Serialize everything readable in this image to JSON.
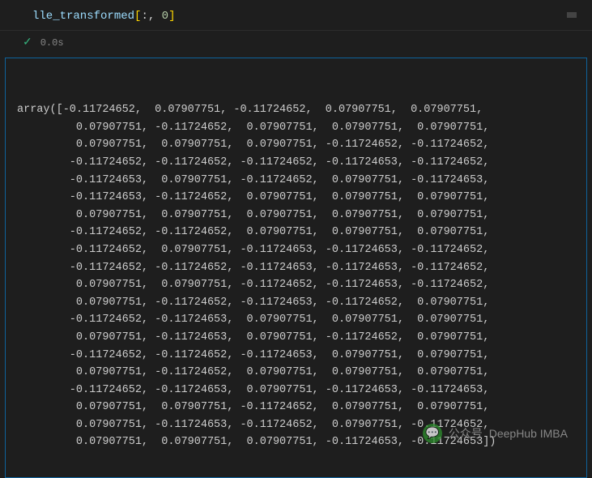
{
  "cell": {
    "code": {
      "var": "lle_transformed",
      "open": "[",
      "slice": ":, ",
      "index": "0",
      "close": "]"
    },
    "status": {
      "check": "✓",
      "time": "0.0s"
    }
  },
  "output": {
    "prefix": "array([",
    "suffix": "])",
    "indent": "        ",
    "rows": [
      [
        "-0.11724652",
        " 0.07907751",
        "-0.11724652",
        " 0.07907751",
        " 0.07907751"
      ],
      [
        " 0.07907751",
        "-0.11724652",
        " 0.07907751",
        " 0.07907751",
        " 0.07907751"
      ],
      [
        " 0.07907751",
        " 0.07907751",
        " 0.07907751",
        "-0.11724652",
        "-0.11724652"
      ],
      [
        "-0.11724652",
        "-0.11724652",
        "-0.11724652",
        "-0.11724653",
        "-0.11724652"
      ],
      [
        "-0.11724653",
        " 0.07907751",
        "-0.11724652",
        " 0.07907751",
        "-0.11724653"
      ],
      [
        "-0.11724653",
        "-0.11724652",
        " 0.07907751",
        " 0.07907751",
        " 0.07907751"
      ],
      [
        " 0.07907751",
        " 0.07907751",
        " 0.07907751",
        " 0.07907751",
        " 0.07907751"
      ],
      [
        "-0.11724652",
        "-0.11724652",
        " 0.07907751",
        " 0.07907751",
        " 0.07907751"
      ],
      [
        "-0.11724652",
        " 0.07907751",
        "-0.11724653",
        "-0.11724653",
        "-0.11724652"
      ],
      [
        "-0.11724652",
        "-0.11724652",
        "-0.11724653",
        "-0.11724653",
        "-0.11724652"
      ],
      [
        " 0.07907751",
        " 0.07907751",
        "-0.11724652",
        "-0.11724653",
        "-0.11724652"
      ],
      [
        " 0.07907751",
        "-0.11724652",
        "-0.11724653",
        "-0.11724652",
        " 0.07907751"
      ],
      [
        "-0.11724652",
        "-0.11724653",
        " 0.07907751",
        " 0.07907751",
        " 0.07907751"
      ],
      [
        " 0.07907751",
        "-0.11724653",
        " 0.07907751",
        "-0.11724652",
        " 0.07907751"
      ],
      [
        "-0.11724652",
        "-0.11724652",
        "-0.11724653",
        " 0.07907751",
        " 0.07907751"
      ],
      [
        " 0.07907751",
        "-0.11724652",
        " 0.07907751",
        " 0.07907751",
        " 0.07907751"
      ],
      [
        "-0.11724652",
        "-0.11724653",
        " 0.07907751",
        "-0.11724653",
        "-0.11724653"
      ],
      [
        " 0.07907751",
        " 0.07907751",
        "-0.11724652",
        " 0.07907751",
        " 0.07907751"
      ],
      [
        " 0.07907751",
        "-0.11724653",
        "-0.11724652",
        " 0.07907751",
        "-0.11724652"
      ],
      [
        " 0.07907751",
        " 0.07907751",
        " 0.07907751",
        "-0.11724653",
        "-0.11724653"
      ]
    ]
  },
  "watermark": {
    "icon": "💬",
    "label": "公众号",
    "brand": "DeepHub IMBA"
  }
}
